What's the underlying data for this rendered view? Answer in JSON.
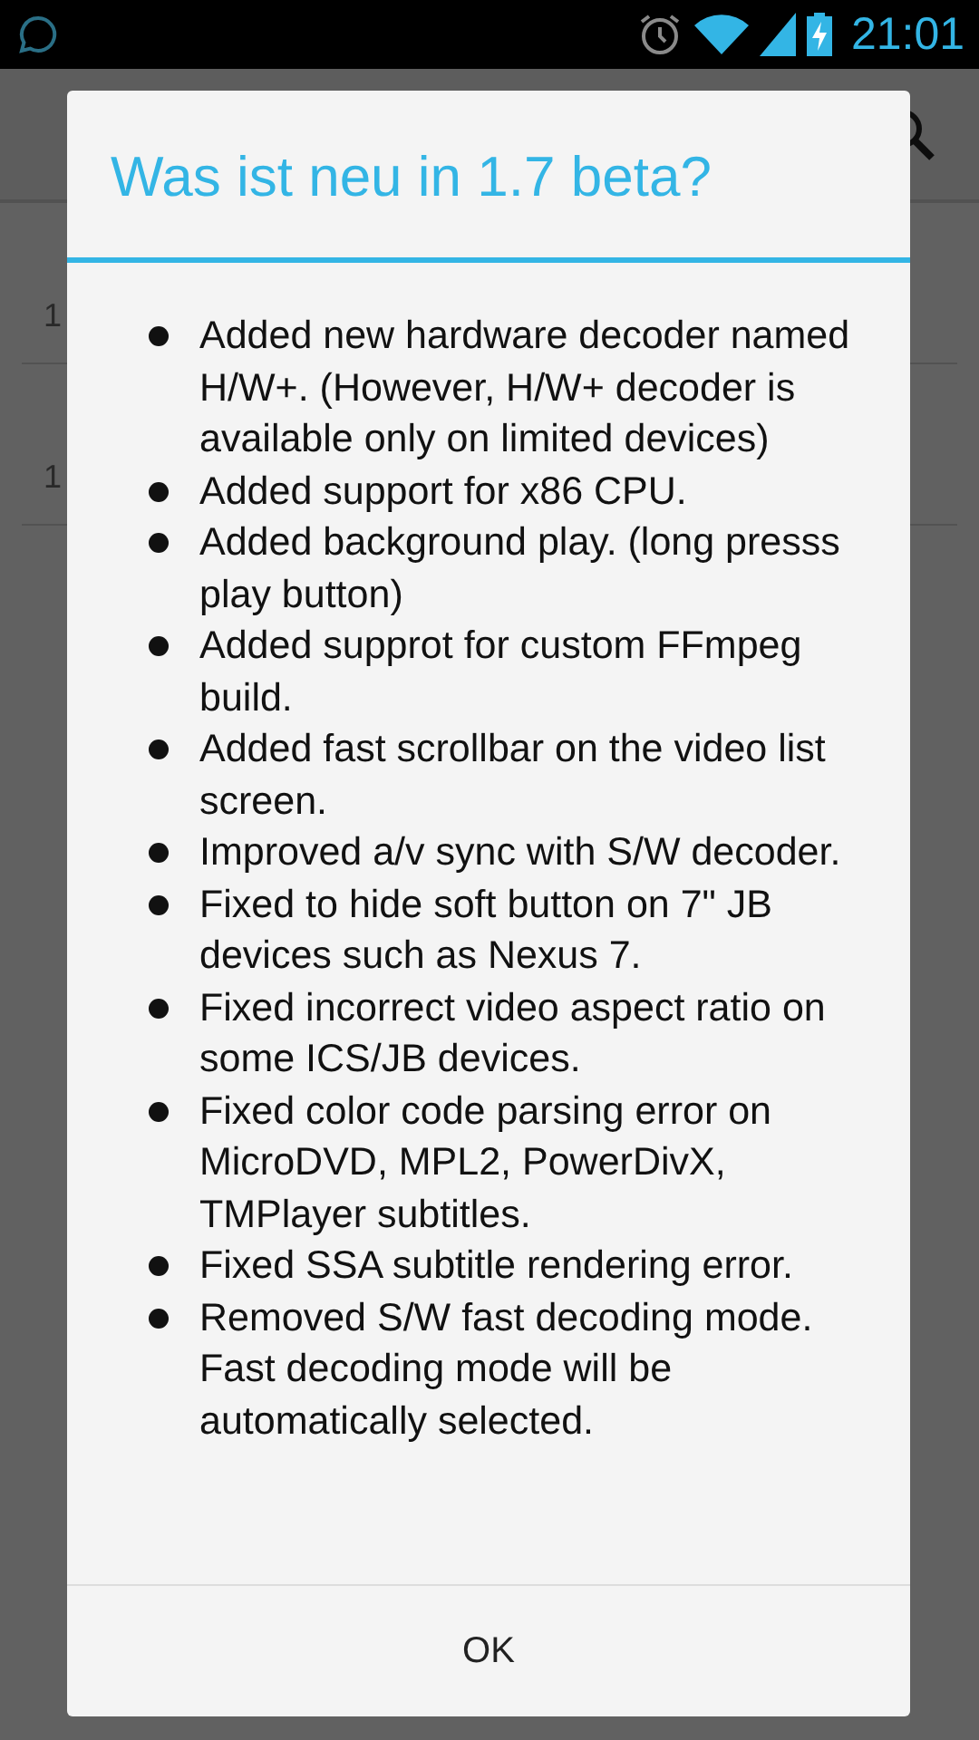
{
  "status_bar": {
    "time": "21:01"
  },
  "list": [
    {
      "subtitle": "1"
    },
    {
      "subtitle": "1"
    }
  ],
  "dialog": {
    "title": "Was ist neu in 1.7 beta?",
    "items": [
      "Added new hardware decoder named H/W+. (However, H/W+ decoder is available only on limited devices)",
      "Added support for x86 CPU.",
      "Added background play. (long presss play button)",
      "Added supprot for custom FFmpeg build.",
      "Added fast scrollbar on the video list screen.",
      "Improved a/v sync with S/W decoder.",
      "Fixed to hide soft button on 7\" JB devices such as Nexus 7.",
      "Fixed incorrect video aspect ratio on some ICS/JB devices.",
      "Fixed color code parsing error on MicroDVD, MPL2, PowerDivX, TMPlayer subtitles.",
      "Fixed SSA subtitle rendering error.",
      "Removed S/W fast decoding mode. Fast decoding mode will be automatically selected."
    ],
    "buttons": [
      "OK"
    ]
  }
}
